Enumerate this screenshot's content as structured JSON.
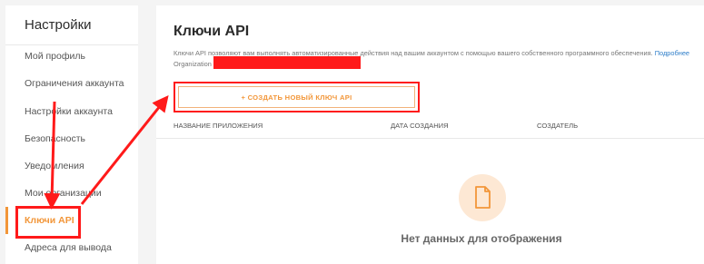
{
  "sidebar": {
    "title": "Настройки",
    "items": [
      {
        "label": "Мой профиль"
      },
      {
        "label": "Ограничения аккаунта"
      },
      {
        "label": "Настройки аккаунта"
      },
      {
        "label": "Безопасность"
      },
      {
        "label": "Уведомления"
      },
      {
        "label": "Мои организации"
      },
      {
        "label": "Ключи API",
        "active": true
      },
      {
        "label": "Адреса для вывода"
      }
    ]
  },
  "main": {
    "title": "Ключи API",
    "description": "Ключи API позволяют вам выполнять автоматизированные действия над вашим аккаунтом с помощью вашего собственного программного обеспечения.",
    "description_link": "Подробнее",
    "organization_label": "Organization",
    "create_button_label": "+ СОЗДАТЬ НОВЫЙ КЛЮЧ API",
    "table": {
      "columns": [
        "НАЗВАНИЕ ПРИЛОЖЕНИЯ",
        "ДАТА СОЗДАНИЯ",
        "СОЗДАТЕЛЬ"
      ]
    },
    "empty_state": {
      "icon": "document-icon",
      "text": "Нет данных для отображения"
    }
  },
  "colors": {
    "accent": "#f29639",
    "annotation": "#ff1a1a",
    "link": "#2e7ec9"
  }
}
